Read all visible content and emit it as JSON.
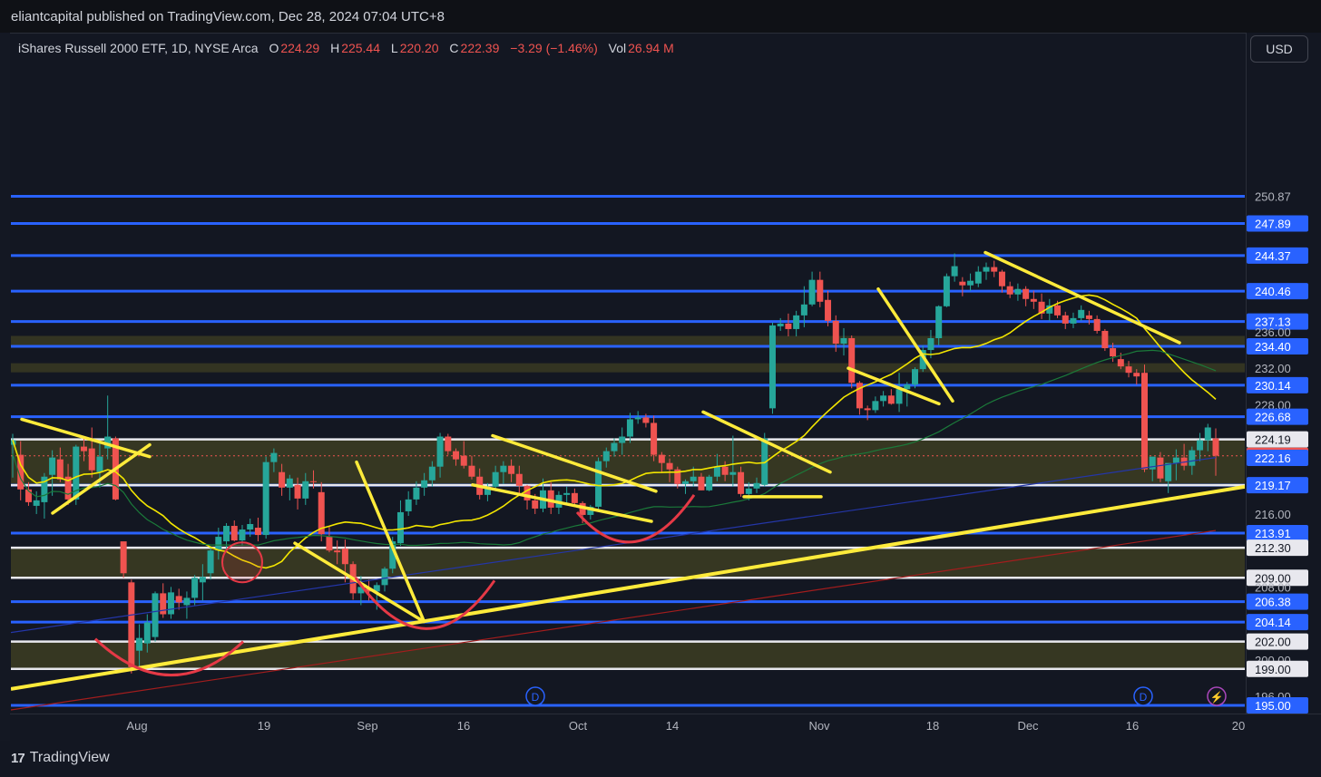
{
  "header": {
    "published": "eliantcapital published on TradingView.com, Dec 28, 2024 07:04 UTC+8"
  },
  "legend": {
    "symbol": "iShares Russell 2000 ETF, 1D, NYSE Arca",
    "o_label": "O",
    "o_value": "224.29",
    "h_label": "H",
    "h_value": "225.44",
    "l_label": "L",
    "l_value": "220.20",
    "c_label": "C",
    "c_value": "222.39",
    "change": "−3.29 (−1.46%)",
    "vol_label": "Vol",
    "vol_value": "26.94 M"
  },
  "toolbar": {
    "currency": "USD"
  },
  "footer": {
    "brand": "TradingView",
    "logo_mark": "17"
  },
  "colors": {
    "bg": "#131722",
    "up": "#26a69a",
    "down": "#ef5350",
    "level_line": "#2962ff",
    "trendline": "#ffeb3b",
    "zone": "#4a4a2a",
    "arc": "#e53946"
  },
  "events": [
    {
      "label": "D",
      "icon": "dividend-icon",
      "x_label": "Sep 27"
    },
    {
      "label": "D",
      "icon": "dividend-icon",
      "x_label": "Dec 17"
    },
    {
      "label": "⚡",
      "icon": "lightning-icon",
      "x_label": "Dec 27"
    }
  ],
  "chart_data": {
    "type": "candlestick",
    "title": "iShares Russell 2000 ETF, 1D, NYSE Arca",
    "ylim": [
      194.5,
      251.5
    ],
    "x_ticks": [
      "Aug",
      "19",
      "Sep",
      "16",
      "Oct",
      "14",
      "Nov",
      "18",
      "Dec",
      "16",
      "20"
    ],
    "y_ticks": [
      250.87,
      247.89,
      244.37,
      240.46,
      237.13,
      236.0,
      234.4,
      232.0,
      230.14,
      228.0,
      226.68,
      224.19,
      222.39,
      222.16,
      219.17,
      216.0,
      213.91,
      212.3,
      209.0,
      208.0,
      206.38,
      204.14,
      202.0,
      200.0,
      199.0,
      196.0,
      195.0
    ],
    "horizontal_levels": [
      250.87,
      247.89,
      244.37,
      240.46,
      237.13,
      234.4,
      230.14,
      226.68,
      219.17,
      213.91,
      206.38,
      204.14,
      195.0
    ],
    "white_levels": [
      224.19,
      219.17,
      212.3,
      209.0,
      202.0,
      199.0
    ],
    "zones": [
      [
        219.17,
        224.19
      ],
      [
        209.0,
        212.3
      ],
      [
        199.0,
        202.0
      ],
      [
        234.4,
        235.55
      ],
      [
        231.55,
        232.55
      ]
    ],
    "last_price": 222.39,
    "series": [
      {
        "name": "ohlc",
        "values": [
          [
            223.6,
            224.8,
            220.0,
            224.1
          ],
          [
            222.5,
            224.0,
            217.5,
            218.7
          ],
          [
            218.7,
            219.5,
            216.9,
            217.3
          ],
          [
            216.9,
            218.5,
            216.0,
            217.5
          ],
          [
            217.3,
            220.5,
            215.5,
            220.1
          ],
          [
            220.3,
            223.0,
            218.0,
            222.2
          ],
          [
            222.0,
            223.3,
            219.5,
            219.8
          ],
          [
            220.1,
            221.5,
            217.0,
            217.6
          ],
          [
            217.6,
            223.6,
            217.0,
            223.4
          ],
          [
            223.4,
            224.5,
            221.8,
            222.9
          ],
          [
            223.2,
            225.5,
            220.0,
            220.8
          ],
          [
            220.6,
            224.0,
            218.9,
            222.3
          ],
          [
            223.2,
            229.0,
            222.0,
            224.5
          ],
          [
            224.3,
            224.5,
            217.5,
            217.6
          ],
          [
            213.0,
            212.0,
            209.0,
            209.5
          ],
          [
            208.5,
            208.8,
            198.5,
            199.2
          ],
          [
            201.0,
            203.9,
            199.3,
            202.4
          ],
          [
            201.8,
            205.0,
            200.8,
            204.1
          ],
          [
            202.5,
            207.5,
            202.0,
            207.3
          ],
          [
            207.3,
            208.4,
            204.6,
            205.0
          ],
          [
            205.0,
            208.0,
            204.5,
            207.4
          ],
          [
            207.0,
            207.8,
            205.5,
            206.3
          ],
          [
            206.0,
            207.5,
            204.5,
            206.8
          ],
          [
            206.8,
            209.3,
            206.0,
            209.0
          ],
          [
            208.5,
            210.5,
            206.5,
            209.1
          ],
          [
            209.5,
            212.5,
            208.8,
            212.0
          ],
          [
            212.0,
            214.5,
            211.0,
            213.5
          ],
          [
            213.0,
            215.0,
            212.0,
            214.7
          ],
          [
            214.7,
            215.3,
            213.0,
            213.1
          ],
          [
            213.1,
            214.8,
            212.5,
            214.3
          ],
          [
            214.3,
            215.5,
            213.5,
            214.9
          ],
          [
            214.5,
            215.6,
            213.0,
            213.7
          ],
          [
            213.7,
            222.3,
            213.3,
            221.7
          ],
          [
            221.7,
            223.2,
            220.6,
            222.7
          ],
          [
            220.6,
            221.5,
            218.0,
            218.9
          ],
          [
            218.9,
            220.3,
            217.5,
            219.9
          ],
          [
            219.2,
            220.0,
            216.5,
            217.7
          ],
          [
            217.7,
            220.5,
            217.0,
            219.6
          ],
          [
            219.6,
            220.8,
            218.8,
            219.5
          ],
          [
            218.4,
            219.5,
            213.0,
            213.8
          ],
          [
            213.5,
            214.6,
            211.8,
            212.0
          ],
          [
            212.0,
            213.1,
            210.5,
            211.8
          ],
          [
            212.2,
            213.2,
            208.5,
            210.5
          ],
          [
            210.5,
            210.8,
            206.6,
            207.3
          ],
          [
            207.3,
            209.2,
            206.0,
            208.0
          ],
          [
            207.8,
            208.8,
            206.5,
            207.5
          ],
          [
            207.5,
            208.5,
            205.5,
            208.2
          ],
          [
            208.2,
            210.2,
            207.5,
            210.0
          ],
          [
            210.0,
            213.5,
            209.5,
            213.0
          ],
          [
            212.8,
            217.5,
            212.5,
            216.2
          ],
          [
            216.3,
            218.5,
            215.8,
            217.6
          ],
          [
            217.6,
            219.6,
            217.0,
            218.9
          ],
          [
            218.9,
            220.5,
            218.0,
            219.7
          ],
          [
            219.7,
            221.8,
            219.0,
            221.2
          ],
          [
            221.2,
            224.9,
            220.0,
            224.5
          ],
          [
            224.5,
            224.8,
            222.5,
            222.9
          ],
          [
            222.9,
            223.2,
            221.3,
            222.0
          ],
          [
            222.4,
            224.0,
            221.0,
            221.3
          ],
          [
            221.3,
            222.4,
            219.8,
            220.1
          ],
          [
            220.1,
            221.0,
            217.6,
            218.1
          ],
          [
            218.1,
            219.4,
            217.4,
            219.0
          ],
          [
            219.0,
            221.3,
            218.5,
            220.6
          ],
          [
            220.6,
            221.8,
            219.3,
            221.3
          ],
          [
            221.3,
            222.0,
            219.5,
            220.4
          ],
          [
            220.4,
            221.3,
            218.0,
            219.1
          ],
          [
            219.1,
            219.2,
            216.5,
            217.5
          ],
          [
            217.5,
            218.2,
            216.0,
            216.6
          ],
          [
            216.6,
            219.9,
            216.2,
            218.6
          ],
          [
            218.6,
            219.5,
            216.0,
            216.7
          ],
          [
            216.7,
            218.5,
            216.0,
            218.1
          ],
          [
            218.1,
            219.0,
            217.2,
            218.3
          ],
          [
            218.3,
            218.8,
            216.8,
            217.2
          ],
          [
            217.2,
            217.4,
            215.0,
            215.9
          ],
          [
            215.9,
            217.0,
            215.4,
            216.8
          ],
          [
            216.8,
            222.2,
            216.3,
            221.8
          ],
          [
            221.8,
            223.3,
            221.1,
            222.9
          ],
          [
            222.9,
            224.3,
            222.3,
            223.8
          ],
          [
            223.8,
            225.5,
            222.5,
            224.5
          ],
          [
            224.5,
            227.1,
            223.8,
            226.4
          ],
          [
            226.4,
            227.3,
            225.9,
            226.6
          ],
          [
            226.6,
            227.0,
            225.5,
            226.0
          ],
          [
            226.0,
            226.8,
            221.8,
            222.5
          ],
          [
            222.5,
            222.8,
            220.5,
            221.6
          ],
          [
            221.6,
            222.1,
            219.5,
            220.9
          ],
          [
            220.9,
            221.2,
            218.8,
            219.3
          ],
          [
            219.3,
            219.8,
            218.2,
            219.6
          ],
          [
            219.6,
            221.2,
            219.0,
            220.1
          ],
          [
            220.1,
            220.5,
            218.6,
            218.6
          ],
          [
            218.6,
            220.3,
            218.5,
            220.1
          ],
          [
            220.1,
            222.6,
            219.6,
            221.2
          ],
          [
            221.2,
            221.8,
            219.6,
            220.3
          ],
          [
            220.3,
            224.6,
            219.0,
            220.6
          ],
          [
            220.6,
            221.2,
            217.9,
            218.2
          ],
          [
            218.2,
            219.5,
            217.5,
            218.8
          ],
          [
            218.8,
            220.0,
            218.3,
            219.4
          ],
          [
            219.2,
            224.9,
            219.0,
            224.3
          ],
          [
            227.6,
            237.0,
            227.0,
            236.7
          ],
          [
            236.6,
            237.5,
            236.1,
            236.9
          ],
          [
            236.9,
            238.0,
            235.5,
            236.3
          ],
          [
            236.3,
            238.3,
            235.5,
            237.8
          ],
          [
            237.8,
            241.0,
            236.5,
            239.0
          ],
          [
            239.0,
            242.6,
            238.8,
            241.7
          ],
          [
            241.7,
            242.6,
            238.7,
            239.3
          ],
          [
            239.5,
            240.5,
            236.6,
            237.2
          ],
          [
            237.2,
            237.8,
            233.8,
            234.7
          ],
          [
            234.7,
            236.4,
            233.4,
            235.3
          ],
          [
            235.3,
            235.6,
            229.8,
            230.4
          ],
          [
            230.4,
            230.6,
            226.9,
            227.6
          ],
          [
            227.6,
            227.9,
            226.3,
            227.4
          ],
          [
            227.4,
            228.9,
            227.1,
            228.4
          ],
          [
            228.4,
            229.5,
            227.8,
            229.0
          ],
          [
            229.0,
            229.7,
            228.0,
            228.1
          ],
          [
            228.1,
            231.5,
            227.2,
            229.7
          ],
          [
            229.7,
            230.5,
            227.8,
            230.2
          ],
          [
            230.2,
            232.1,
            229.8,
            231.9
          ],
          [
            231.9,
            234.5,
            231.6,
            234.0
          ],
          [
            234.0,
            236.2,
            233.1,
            235.3
          ],
          [
            235.3,
            238.9,
            234.5,
            238.8
          ],
          [
            238.8,
            242.4,
            238.7,
            242.1
          ],
          [
            242.1,
            244.6,
            241.5,
            243.2
          ],
          [
            241.5,
            242.0,
            239.9,
            241.1
          ],
          [
            241.1,
            242.4,
            240.5,
            241.6
          ],
          [
            241.3,
            243.2,
            240.9,
            242.6
          ],
          [
            242.6,
            243.6,
            241.7,
            243.1
          ],
          [
            243.1,
            243.8,
            242.0,
            242.6
          ],
          [
            242.6,
            242.8,
            240.3,
            241.0
          ],
          [
            241.0,
            241.5,
            239.7,
            240.1
          ],
          [
            240.1,
            241.3,
            239.4,
            240.7
          ],
          [
            240.7,
            241.0,
            238.8,
            239.6
          ],
          [
            239.6,
            240.5,
            238.5,
            239.3
          ],
          [
            239.3,
            240.2,
            237.4,
            238.0
          ],
          [
            238.0,
            239.6,
            237.2,
            238.9
          ],
          [
            238.9,
            239.4,
            237.5,
            237.8
          ],
          [
            237.8,
            238.2,
            236.3,
            236.9
          ],
          [
            236.9,
            238.1,
            236.4,
            237.5
          ],
          [
            237.5,
            238.9,
            237.2,
            238.4
          ],
          [
            237.8,
            238.3,
            236.8,
            237.4
          ],
          [
            237.4,
            237.8,
            235.8,
            236.1
          ],
          [
            236.1,
            236.3,
            233.9,
            234.2
          ],
          [
            234.2,
            234.8,
            232.7,
            233.3
          ],
          [
            233.0,
            233.7,
            231.9,
            232.2
          ],
          [
            232.2,
            232.8,
            231.0,
            231.5
          ],
          [
            231.5,
            231.9,
            230.2,
            231.1
          ],
          [
            231.5,
            232.4,
            220.6,
            220.9
          ],
          [
            220.9,
            221.6,
            219.6,
            222.3
          ],
          [
            222.2,
            222.8,
            219.5,
            219.9
          ],
          [
            219.6,
            221.4,
            218.3,
            221.6
          ],
          [
            221.6,
            223.1,
            219.7,
            222.2
          ],
          [
            222.2,
            223.7,
            220.8,
            221.3
          ],
          [
            221.3,
            223.4,
            220.3,
            223.0
          ],
          [
            223.0,
            224.9,
            221.8,
            224.1
          ],
          [
            224.1,
            225.9,
            222.9,
            225.5
          ],
          [
            224.3,
            225.4,
            220.2,
            222.4
          ]
        ]
      }
    ]
  }
}
